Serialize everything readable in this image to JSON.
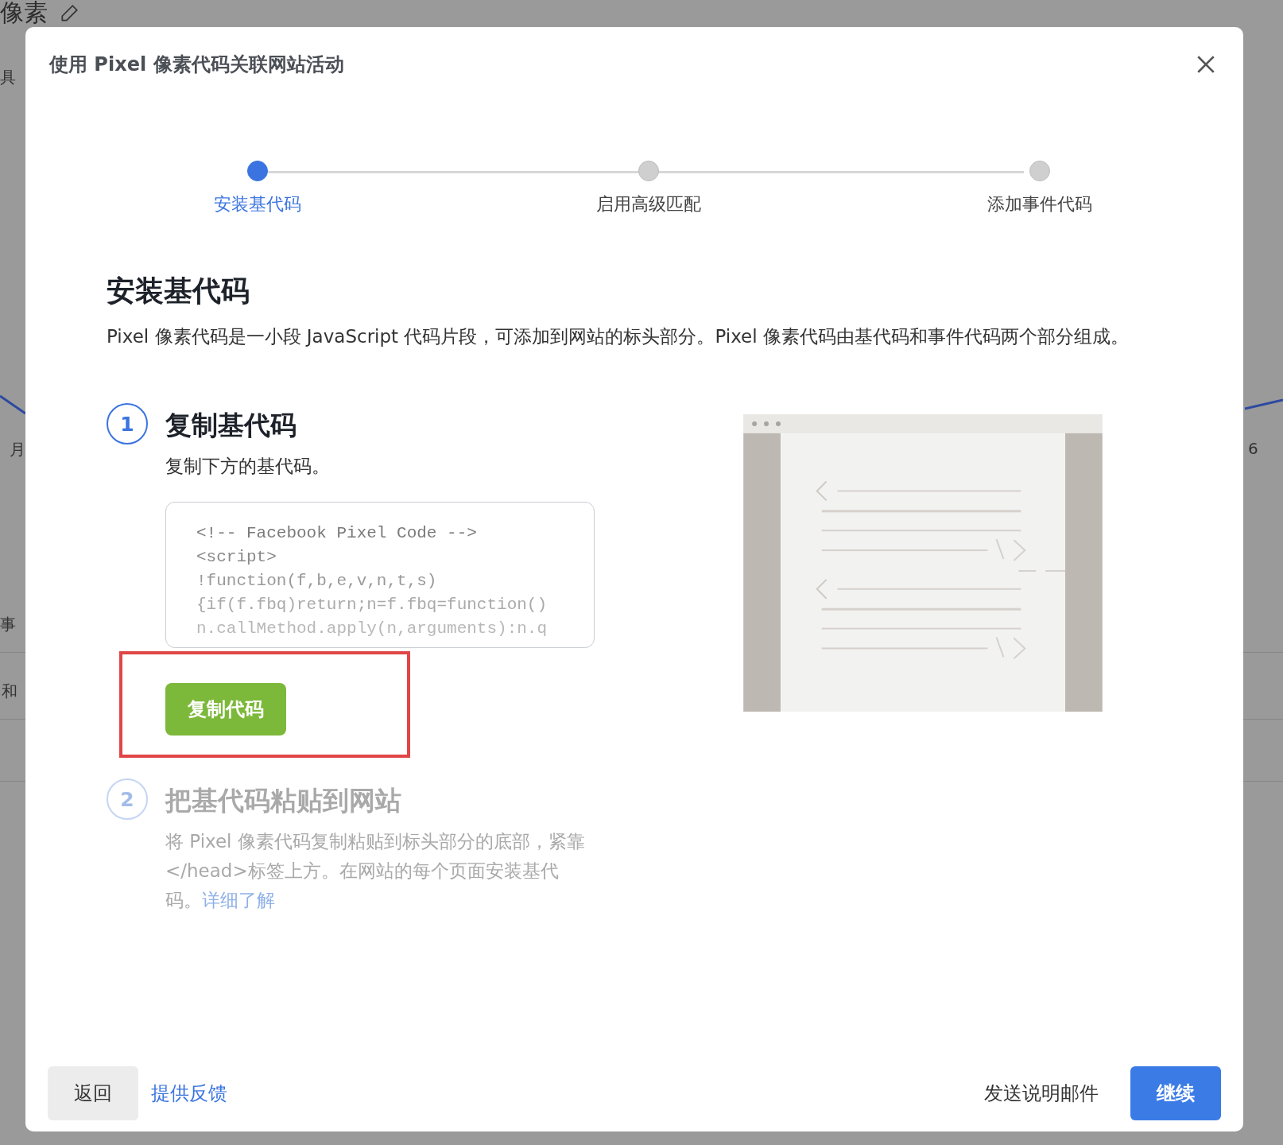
{
  "background": {
    "title": "像素",
    "texts": [
      {
        "text": "具"
      },
      {
        "text": "月"
      },
      {
        "text": "事"
      },
      {
        "text": "和"
      },
      {
        "text": "6"
      }
    ]
  },
  "dialog": {
    "title": "使用 Pixel 像素代码关联网站活动",
    "steps": [
      {
        "label": "安装基代码",
        "selected": true
      },
      {
        "label": "启用高级匹配",
        "selected": false
      },
      {
        "label": "添加事件代码",
        "selected": false
      }
    ],
    "heading": "安装基代码",
    "description": "Pixel 像素代码是一小段 JavaScript 代码片段，可添加到网站的标头部分。Pixel 像素代码由基代码和事件代码两个部分组成。",
    "sections": [
      {
        "number": "1",
        "title": "复制基代码",
        "disabled": false,
        "text": "复制下方的基代码。",
        "code": [
          "<!-- Facebook Pixel Code -->",
          "<script>",
          "!function(f,b,e,v,n,t,s)",
          "{if(f.fbq)return;n=f.fbq=function()",
          "n.callMethod.apply(n,arguments):n.q"
        ],
        "button": "复制代码"
      },
      {
        "number": "2",
        "title": "把基代码粘贴到网站",
        "disabled": true,
        "text": "将 Pixel 像素代码复制粘贴到标头部分的底部，紧靠</head>标签上方。在网站的每个页面安装基代码。",
        "link": "详细了解"
      }
    ],
    "footer": {
      "back": "返回",
      "feedback": "提供反馈",
      "email": "发送说明邮件",
      "continue": "继续"
    }
  }
}
